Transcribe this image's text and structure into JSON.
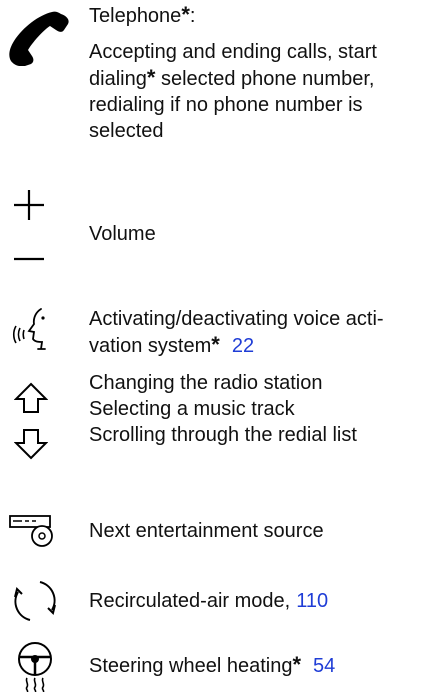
{
  "items": [
    {
      "id": "telephone",
      "icon": "telephone-handset-icon",
      "title": "Telephone",
      "title_suffix": ":",
      "desc_part1": "Accepting and ending calls, start dialing",
      "desc_part2": " selected phone number, redialing if no phone number is selected"
    },
    {
      "id": "volume",
      "icon": "plus-minus-icon",
      "label": "Volume"
    },
    {
      "id": "voice",
      "icon": "voice-activation-icon",
      "label_part1": "Activating/deactivating voice acti-",
      "label_part2": "vation system",
      "page_ref": "22"
    },
    {
      "id": "arrows",
      "icon": "up-down-arrow-icon",
      "lines": [
        "Changing the radio station",
        "Selecting a music track",
        "Scrolling through the redial list"
      ]
    },
    {
      "id": "source",
      "icon": "entertainment-source-icon",
      "label": "Next entertainment source"
    },
    {
      "id": "recirculated",
      "icon": "recirculated-air-icon",
      "label": "Recirculated-air mode,",
      "page_ref": "110"
    },
    {
      "id": "steering",
      "icon": "steering-wheel-heating-icon",
      "label": "Steering wheel heating",
      "page_ref": "54"
    }
  ],
  "optional_marker": "*",
  "colors": {
    "text": "#111111",
    "link": "#1f3dd6"
  }
}
